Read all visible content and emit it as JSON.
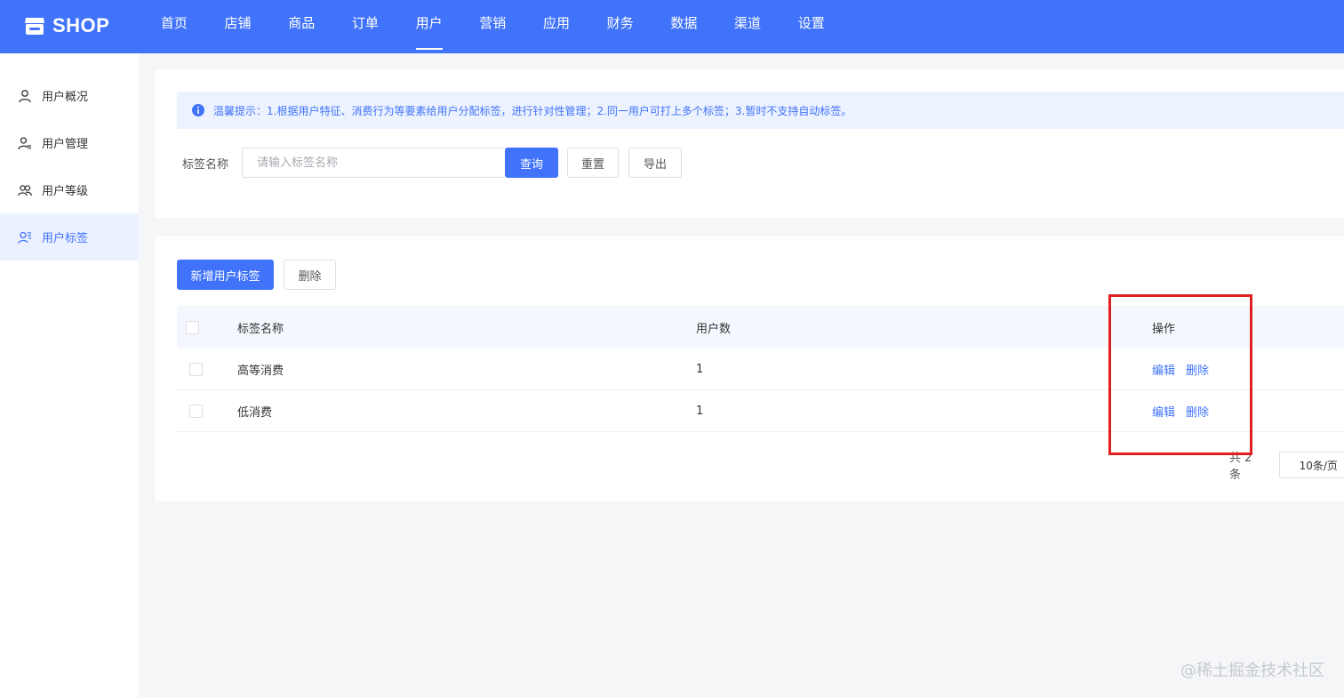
{
  "app": {
    "logo_text": "SHOP",
    "brand_color": "#4073fa",
    "logo_icon": "store-icon"
  },
  "nav": {
    "items": [
      "首页",
      "店铺",
      "商品",
      "订单",
      "用户",
      "营销",
      "应用",
      "财务",
      "数据",
      "渠道",
      "设置"
    ],
    "active": "用户"
  },
  "sidebar": {
    "items": [
      {
        "label": "用户概况",
        "icon": "user-icon"
      },
      {
        "label": "用户管理",
        "icon": "user-list-icon"
      },
      {
        "label": "用户等级",
        "icon": "users-group-icon"
      },
      {
        "label": "用户标签",
        "icon": "user-tag-icon"
      }
    ],
    "active": "用户标签"
  },
  "tip": {
    "icon": "info-icon",
    "text": "温馨提示：1.根据用户特征、消费行为等要素给用户分配标签，进行针对性管理；2.同一用户可打上多个标签；3.暂时不支持自动标签。"
  },
  "filter": {
    "label": "标签名称",
    "placeholder": "请输入标签名称",
    "value": "",
    "search_label": "查询",
    "reset_label": "重置",
    "export_label": "导出"
  },
  "actions": {
    "add_label": "新增用户标签",
    "delete_label": "删除"
  },
  "table": {
    "columns": [
      "标签名称",
      "用户数",
      "操作"
    ],
    "rows": [
      {
        "name": "高等消费",
        "count": "1",
        "edit": "编辑",
        "delete": "删除"
      },
      {
        "name": "低消费",
        "count": "1",
        "edit": "编辑",
        "delete": "删除"
      }
    ]
  },
  "pagination": {
    "total_text": "共 2 条",
    "page_size": "10条/页"
  },
  "annotation": {
    "highlight_color": "#e02020"
  },
  "watermark": "@稀土掘金技术社区"
}
